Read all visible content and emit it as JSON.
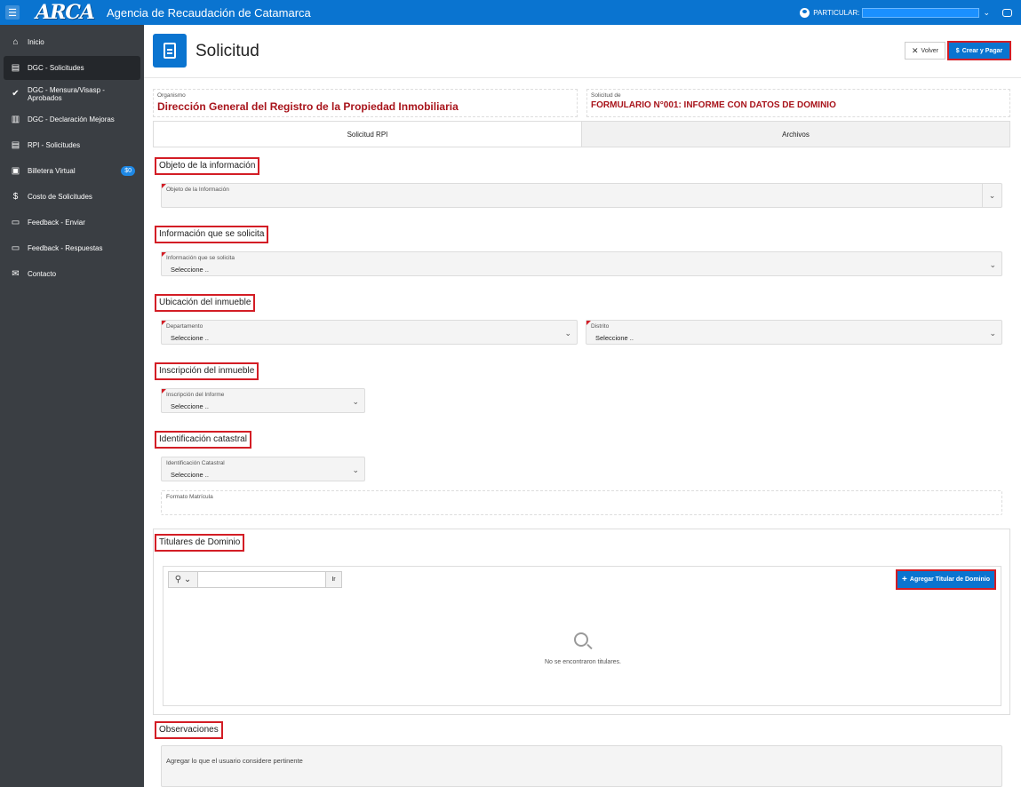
{
  "header": {
    "logo": "ARCA",
    "app_title": "Agencia de Recaudación de Catamarca",
    "user_label": "PARTICULAR:"
  },
  "sidebar": {
    "items": [
      {
        "label": "Inicio",
        "icon": "home-icon"
      },
      {
        "label": "DGC - Solicitudes",
        "icon": "document-icon"
      },
      {
        "label": "DGC - Mensura/Visasp - Aprobados",
        "icon": "check-circle-icon"
      },
      {
        "label": "DGC - Declaración Mejoras",
        "icon": "building-icon"
      },
      {
        "label": "RPI - Solicitudes",
        "icon": "document-icon"
      },
      {
        "label": "Billetera Virtual",
        "icon": "wallet-icon",
        "badge": "$0"
      },
      {
        "label": "Costo de Solicitudes",
        "icon": "dollar-icon"
      },
      {
        "label": "Feedback - Enviar",
        "icon": "chat-icon"
      },
      {
        "label": "Feedback - Respuestas",
        "icon": "chat-icon"
      },
      {
        "label": "Contacto",
        "icon": "mail-icon"
      }
    ]
  },
  "page": {
    "title": "Solicitud",
    "volver_label": "Volver",
    "crear_label": "Crear y Pagar",
    "organismo_label": "Organismo",
    "organismo_value": "Dirección General del Registro de la Propiedad Inmobiliaria",
    "solicitud_label": "Solicitud de",
    "solicitud_value": "FORMULARIO N°001: INFORME CON DATOS DE DOMINIO"
  },
  "tabs": [
    {
      "label": "Solicitud RPI",
      "active": true
    },
    {
      "label": "Archivos",
      "active": false
    }
  ],
  "sections": {
    "objeto": {
      "title": "Objeto de la información",
      "field_label": "Objeto de la Información"
    },
    "informacion": {
      "title": "Información que se solicita",
      "field_label": "Información que se solicita",
      "value": "Seleccione .."
    },
    "ubicacion": {
      "title": "Ubicación del inmueble",
      "departamento_label": "Departamento",
      "departamento_value": "Seleccione ..",
      "distrito_label": "Distrito",
      "distrito_value": "Seleccione .."
    },
    "inscripcion": {
      "title": "Inscripción del inmueble",
      "field_label": "Inscripción del Informe",
      "value": "Seleccione .."
    },
    "identificacion": {
      "title": "Identificación catastral",
      "field_label": "Identificación Catastral",
      "value": "Seleccione ..",
      "matricula_label": "Formato Matrícula"
    },
    "titulares": {
      "title": "Titulares de Dominio",
      "go_label": "Ir",
      "add_label": "Agregar Titular de Dominio",
      "empty_text": "No se encontraron titulares."
    },
    "observaciones": {
      "title": "Observaciones",
      "placeholder": "Agregar lo que el usuario considere pertinente"
    }
  },
  "colors": {
    "primary": "#0a74d0",
    "highlight": "#d31d25",
    "sidebar": "#3a3e43",
    "accent_text": "#a8141b"
  }
}
